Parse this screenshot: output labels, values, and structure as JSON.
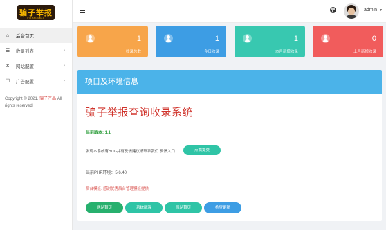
{
  "logo": {
    "text": "骗子举报",
    "sub": "PIANZIJUBAO"
  },
  "sidebar": {
    "items": [
      {
        "icon": "⌂",
        "label": "后台首页"
      },
      {
        "icon": "☰",
        "label": "收录列表"
      },
      {
        "icon": "✕",
        "label": "网站配置"
      },
      {
        "icon": "☐",
        "label": "广告配置"
      }
    ],
    "copyright_prefix": "Copyright © 2021.",
    "copyright_brand": "骗子产品",
    "copyright_suffix": "All rights reserved."
  },
  "topbar": {
    "username": "admin",
    "caret": "▼"
  },
  "cards": [
    {
      "value": "1",
      "label": "收录总数",
      "color": "#f7a54a"
    },
    {
      "value": "1",
      "label": "今日收录",
      "color": "#3d9de4"
    },
    {
      "value": "1",
      "label": "本月新增收录",
      "color": "#38c8b0"
    },
    {
      "value": "0",
      "label": "上月新增收录",
      "color": "#f15c5c"
    }
  ],
  "panel": {
    "header": "项目及环境信息",
    "title": "骗子举报查询收录系统",
    "version": "当前版本: 1.1",
    "feedback": "发现本系统有BUG并有反馈建议请联系我们 反馈入口",
    "feedback_button": "点我提交",
    "php": "当前PHP环境：5.6.40",
    "admin_note": "后台模板: 感谢优秀后台管理模板提供",
    "buttons": [
      {
        "label": "网站首页",
        "color": "#27b06e"
      },
      {
        "label": "系统配置",
        "color": "#2fc4a6"
      },
      {
        "label": "网站首页",
        "color": "#2fc4a6"
      },
      {
        "label": "检查更新",
        "color": "#3d9de4"
      }
    ]
  }
}
